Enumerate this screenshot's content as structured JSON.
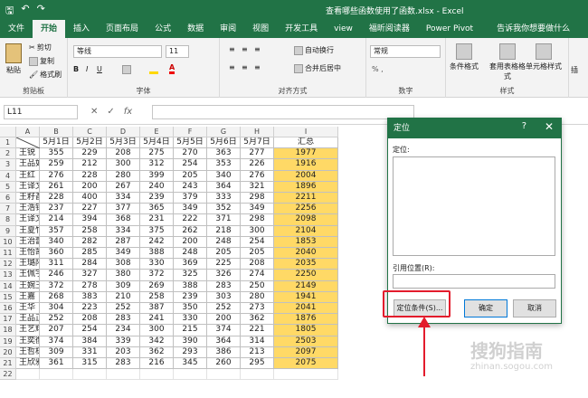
{
  "titlebar": {
    "doc_title": "查看哪些函数使用了函数.xlsx - Excel",
    "save_icon": "save-icon",
    "undo_icon": "undo-icon",
    "redo_icon": "redo-icon"
  },
  "tabs": [
    "文件",
    "开始",
    "插入",
    "页面布局",
    "公式",
    "数据",
    "审阅",
    "视图",
    "开发工具",
    "view",
    "福昕阅读器",
    "Power Pivot"
  ],
  "active_tab": "开始",
  "tell_me": "告诉我你想要做什么",
  "ribbon": {
    "clipboard": {
      "paste": "粘贴",
      "cut": "剪切",
      "copy": "复制",
      "format_painter": "格式刷",
      "label": "剪贴板"
    },
    "font": {
      "name": "等线",
      "size": "11",
      "bold": "B",
      "italic": "I",
      "underline": "U",
      "label": "字体"
    },
    "alignment": {
      "wrap": "自动换行",
      "merge": "合并后居中",
      "label": "对齐方式"
    },
    "number": {
      "format": "常规",
      "label": "数字"
    },
    "styles": {
      "conditional": "条件格式",
      "table": "套用表格格式",
      "cell": "单元格样式",
      "label": "样式"
    },
    "insert_label": "插"
  },
  "formula_bar": {
    "name_box": "L11",
    "cancel": "✕",
    "enter": "✓",
    "fx": "fx"
  },
  "sheet": {
    "columns": [
      "A",
      "B",
      "C",
      "D",
      "E",
      "F",
      "G",
      "H",
      "I"
    ],
    "header_row": [
      "",
      "5月1日",
      "5月2日",
      "5月3日",
      "5月4日",
      "5月5日",
      "5月6日",
      "5月7日",
      "汇总"
    ],
    "rows": [
      [
        "王锐",
        "355",
        "229",
        "208",
        "275",
        "270",
        "363",
        "277",
        "1977"
      ],
      [
        "王品如",
        "259",
        "212",
        "300",
        "312",
        "254",
        "353",
        "226",
        "1916"
      ],
      [
        "王红",
        "276",
        "228",
        "280",
        "399",
        "205",
        "340",
        "276",
        "2004"
      ],
      [
        "王译文",
        "261",
        "200",
        "267",
        "240",
        "243",
        "364",
        "321",
        "1896"
      ],
      [
        "王籽萏",
        "228",
        "400",
        "334",
        "239",
        "379",
        "333",
        "298",
        "2211"
      ],
      [
        "王浩铭",
        "237",
        "227",
        "377",
        "365",
        "349",
        "352",
        "349",
        "2256"
      ],
      [
        "王译文",
        "214",
        "394",
        "368",
        "231",
        "222",
        "371",
        "298",
        "2098"
      ],
      [
        "王夏竹",
        "357",
        "258",
        "334",
        "375",
        "262",
        "218",
        "300",
        "2104"
      ],
      [
        "王治蕾",
        "340",
        "282",
        "287",
        "242",
        "200",
        "248",
        "254",
        "1853"
      ],
      [
        "王怡凯",
        "360",
        "285",
        "349",
        "388",
        "248",
        "205",
        "205",
        "2040"
      ],
      [
        "王璐阳",
        "311",
        "284",
        "308",
        "330",
        "369",
        "225",
        "208",
        "2035"
      ],
      [
        "王佩宇",
        "246",
        "327",
        "380",
        "372",
        "325",
        "326",
        "274",
        "2250"
      ],
      [
        "王婉玉",
        "372",
        "278",
        "309",
        "269",
        "388",
        "283",
        "250",
        "2149"
      ],
      [
        "王嘉",
        "268",
        "383",
        "210",
        "258",
        "239",
        "303",
        "280",
        "1941"
      ],
      [
        "王华",
        "304",
        "223",
        "252",
        "387",
        "350",
        "252",
        "273",
        "2041"
      ],
      [
        "王品正",
        "252",
        "208",
        "283",
        "241",
        "330",
        "200",
        "362",
        "1876"
      ],
      [
        "王艺辉",
        "207",
        "254",
        "234",
        "300",
        "215",
        "374",
        "221",
        "1805"
      ],
      [
        "王奕衡",
        "374",
        "384",
        "339",
        "342",
        "390",
        "364",
        "314",
        "2503"
      ],
      [
        "王哲栋",
        "309",
        "331",
        "203",
        "362",
        "293",
        "386",
        "213",
        "2097"
      ],
      [
        "王欣雅",
        "361",
        "315",
        "283",
        "216",
        "345",
        "260",
        "295",
        "2075"
      ]
    ]
  },
  "dialog": {
    "title": "定位",
    "help": "?",
    "close": "✕",
    "goto_label": "定位:",
    "reference_label": "引用位置(R):",
    "special_button": "定位条件(S)...",
    "ok_button": "确定",
    "cancel_button": "取消"
  },
  "watermark": {
    "big": "搜狗指南",
    "small": "zhinan.sogou.com"
  },
  "colors": {
    "excel_green": "#217346",
    "total_fill": "#ffd966",
    "highlight_red": "#e31c2c"
  }
}
